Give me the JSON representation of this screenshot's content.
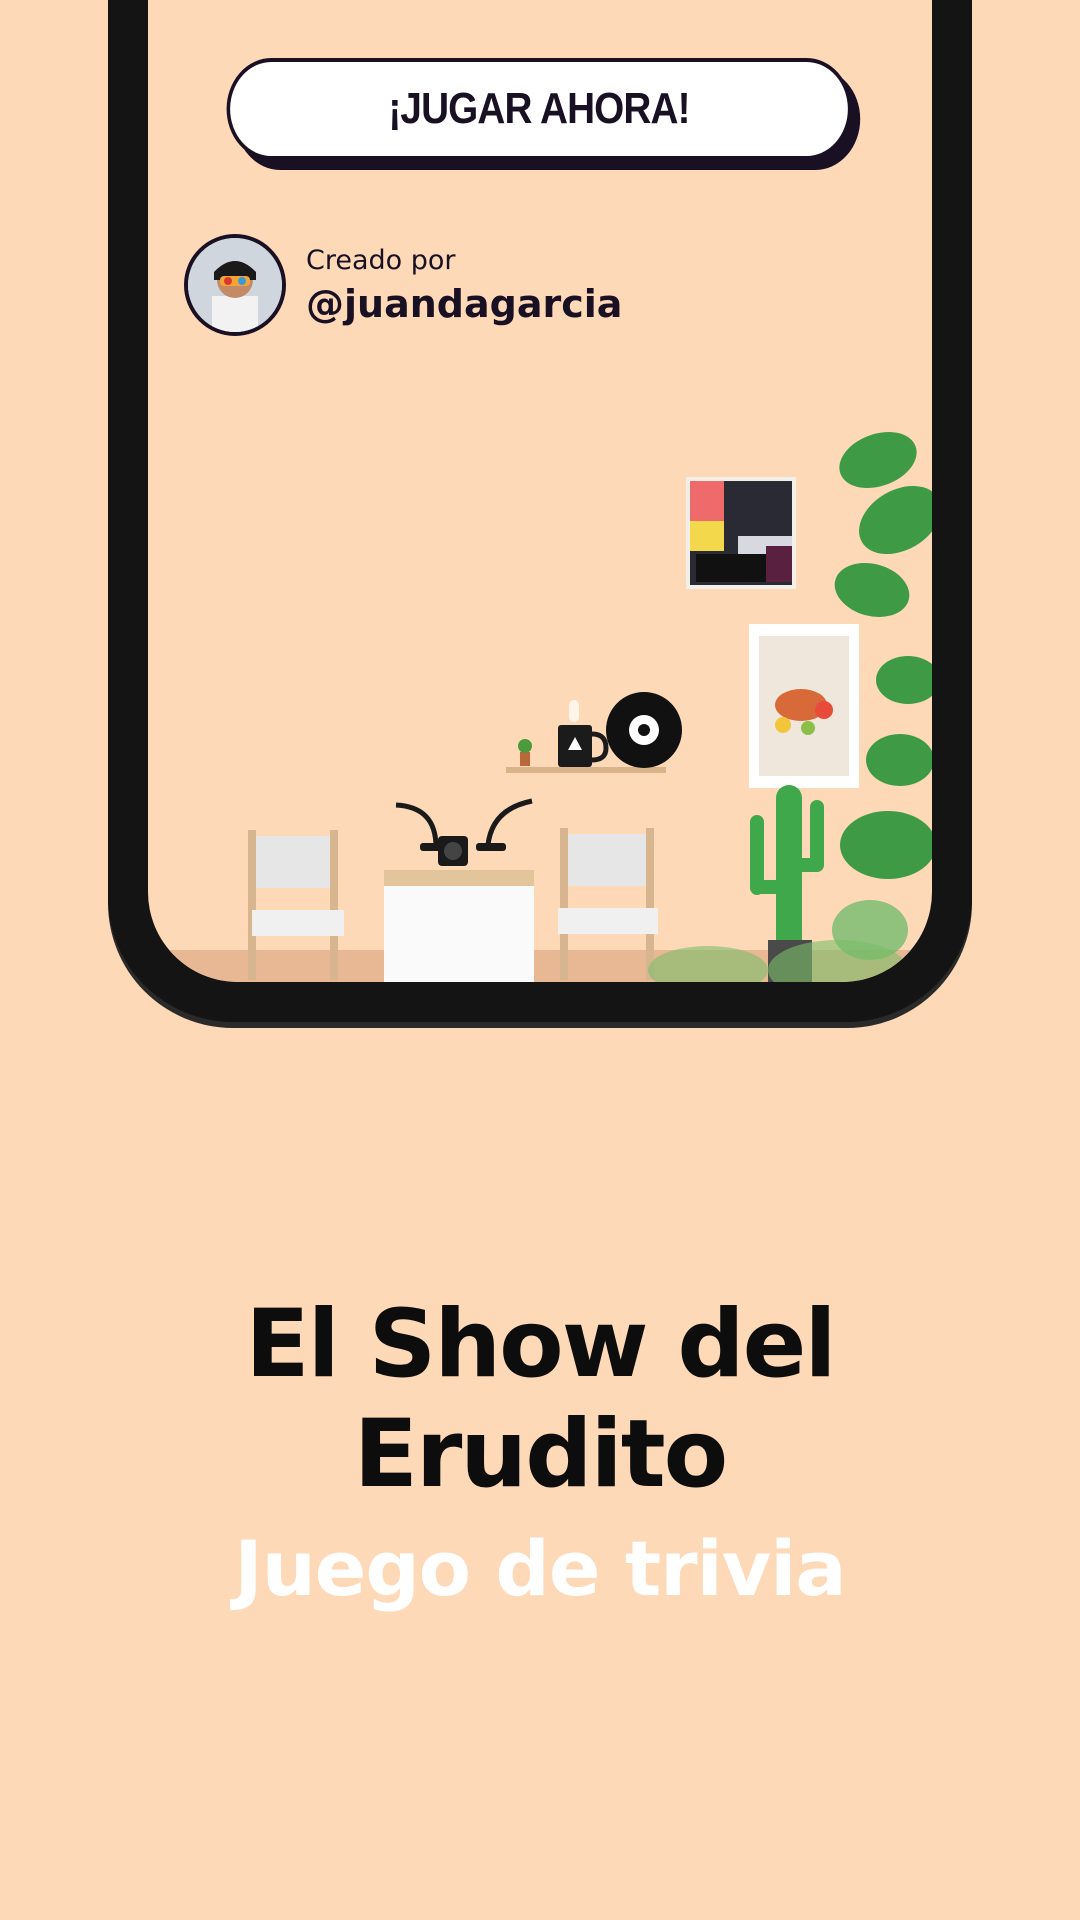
{
  "play_button": {
    "label": "¡JUGAR AHORA!"
  },
  "author": {
    "created_label": "Creado por",
    "username": "@juandagarcia"
  },
  "app": {
    "title": "El Show del Erudito",
    "subtitle": "Juego de trivia"
  },
  "colors": {
    "background": "#FED9B7",
    "phone_frame": "#141414",
    "text_dark": "#1a1024",
    "subtitle": "#FFFFFF"
  }
}
